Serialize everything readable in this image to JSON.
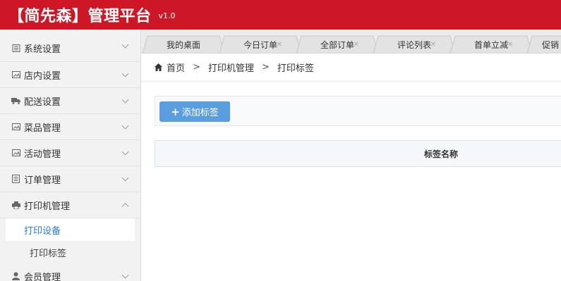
{
  "header": {
    "brand": "【简先森】管理平台",
    "version": "v1.0",
    "bg_color": "#cd1726"
  },
  "sidebar": {
    "items": [
      {
        "label": "系统设置",
        "icon": "doc-list-icon",
        "expanded": false
      },
      {
        "label": "店内设置",
        "icon": "image-icon",
        "expanded": false
      },
      {
        "label": "配送设置",
        "icon": "truck-icon",
        "expanded": false
      },
      {
        "label": "菜品管理",
        "icon": "image-icon",
        "expanded": false
      },
      {
        "label": "活动管理",
        "icon": "image-icon",
        "expanded": false
      },
      {
        "label": "订单管理",
        "icon": "list-icon",
        "expanded": false
      },
      {
        "label": "打印机管理",
        "icon": "printer-icon",
        "expanded": true
      },
      {
        "label": "会员管理",
        "icon": "user-icon",
        "expanded": false
      }
    ],
    "sub_items": [
      {
        "label": "打印设备",
        "active": true
      },
      {
        "label": "打印标签",
        "active": false
      }
    ]
  },
  "tabs": [
    {
      "label": "我的桌面",
      "closable": false
    },
    {
      "label": "今日订单",
      "closable": true
    },
    {
      "label": "全部订单",
      "closable": true
    },
    {
      "label": "评论列表",
      "closable": true
    },
    {
      "label": "首单立减",
      "closable": true
    },
    {
      "label": "促销",
      "closable": false
    }
  ],
  "breadcrumb": {
    "home": "首页",
    "sep": ">",
    "level1": "打印机管理",
    "level2": "打印标签"
  },
  "toolbar": {
    "add_label": "添加标签",
    "add_color": "#5b9ee0"
  },
  "table": {
    "columns": [
      "标签名称"
    ]
  }
}
